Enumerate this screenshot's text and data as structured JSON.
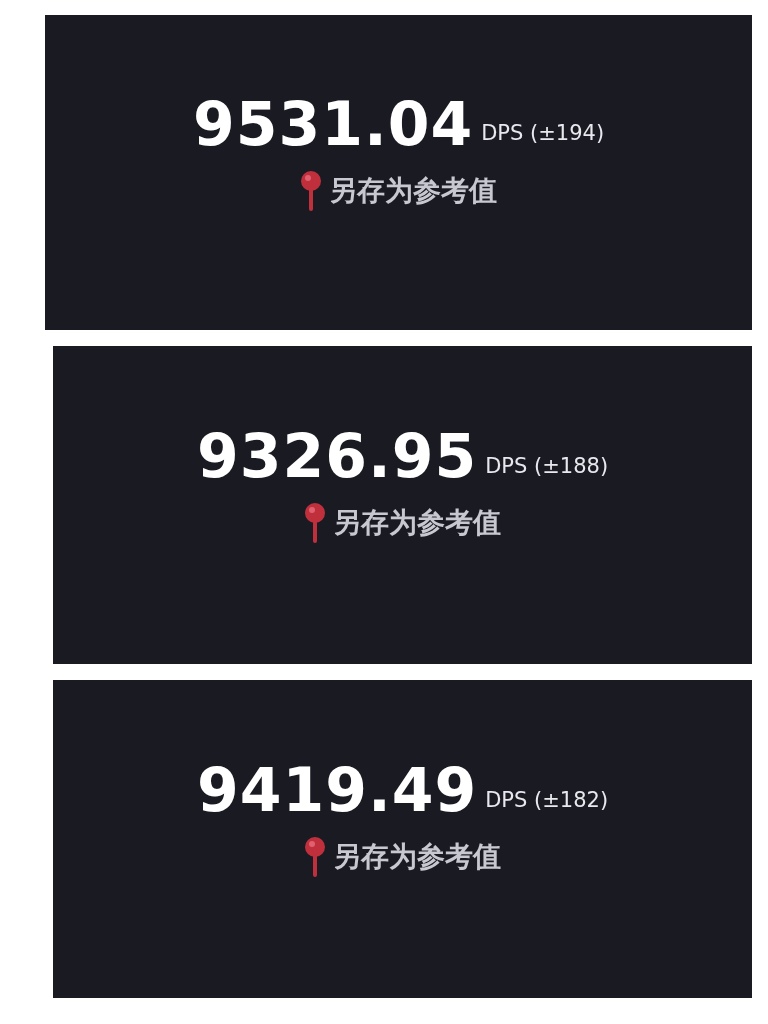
{
  "panels": [
    {
      "value": "9531.04",
      "detail": "DPS (±194)",
      "action": "另存为参考值"
    },
    {
      "value": "9326.95",
      "detail": "DPS (±188)",
      "action": "另存为参考值"
    },
    {
      "value": "9419.49",
      "detail": "DPS (±182)",
      "action": "另存为参考值"
    }
  ]
}
